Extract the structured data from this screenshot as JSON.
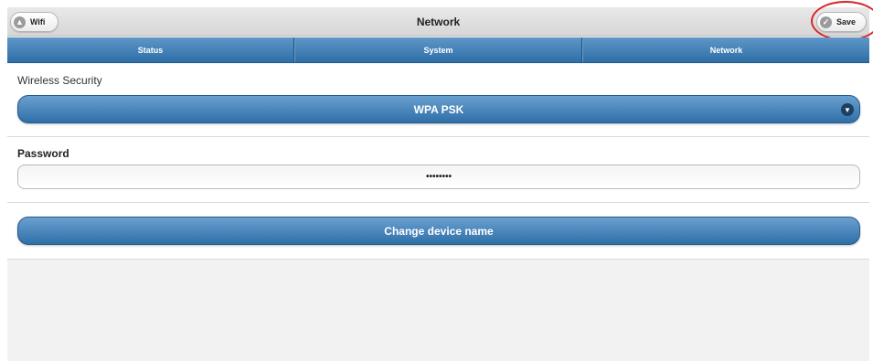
{
  "header": {
    "title": "Network",
    "back_label": "Wifi",
    "back_icon": "arrow-up-circle-icon",
    "save_label": "Save",
    "save_icon": "check-circle-icon"
  },
  "nav": {
    "tabs": [
      {
        "label": "Status"
      },
      {
        "label": "System"
      },
      {
        "label": "Network"
      }
    ]
  },
  "security": {
    "label": "Wireless Security",
    "selected": "WPA PSK",
    "chevron_icon": "chevron-down-icon"
  },
  "password": {
    "label": "Password",
    "value": "••••••••"
  },
  "device": {
    "button_label": "Change device name"
  },
  "colors": {
    "accent_blue": "#3f7bb5",
    "highlight_red": "#d7262b"
  }
}
